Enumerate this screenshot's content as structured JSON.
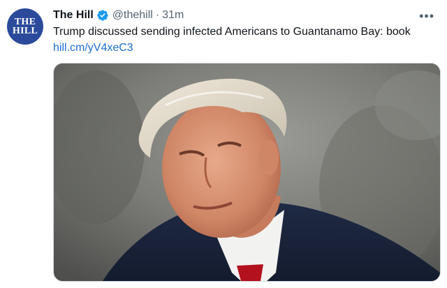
{
  "tweet": {
    "avatar": {
      "line1": "THE",
      "line2": "HILL",
      "color": "#2b4a9b"
    },
    "author_name": "The Hill",
    "verified_icon": "verified-badge-icon",
    "handle": "@thehill",
    "separator": "·",
    "time": "31m",
    "more_icon": "more-options-icon",
    "text": "Trump discussed sending infected Americans to Guantanamo Bay: book",
    "link": "hill.cm/yV4xeC3",
    "link_color": "#1d6ecf",
    "media": {
      "alt": "photo"
    }
  }
}
